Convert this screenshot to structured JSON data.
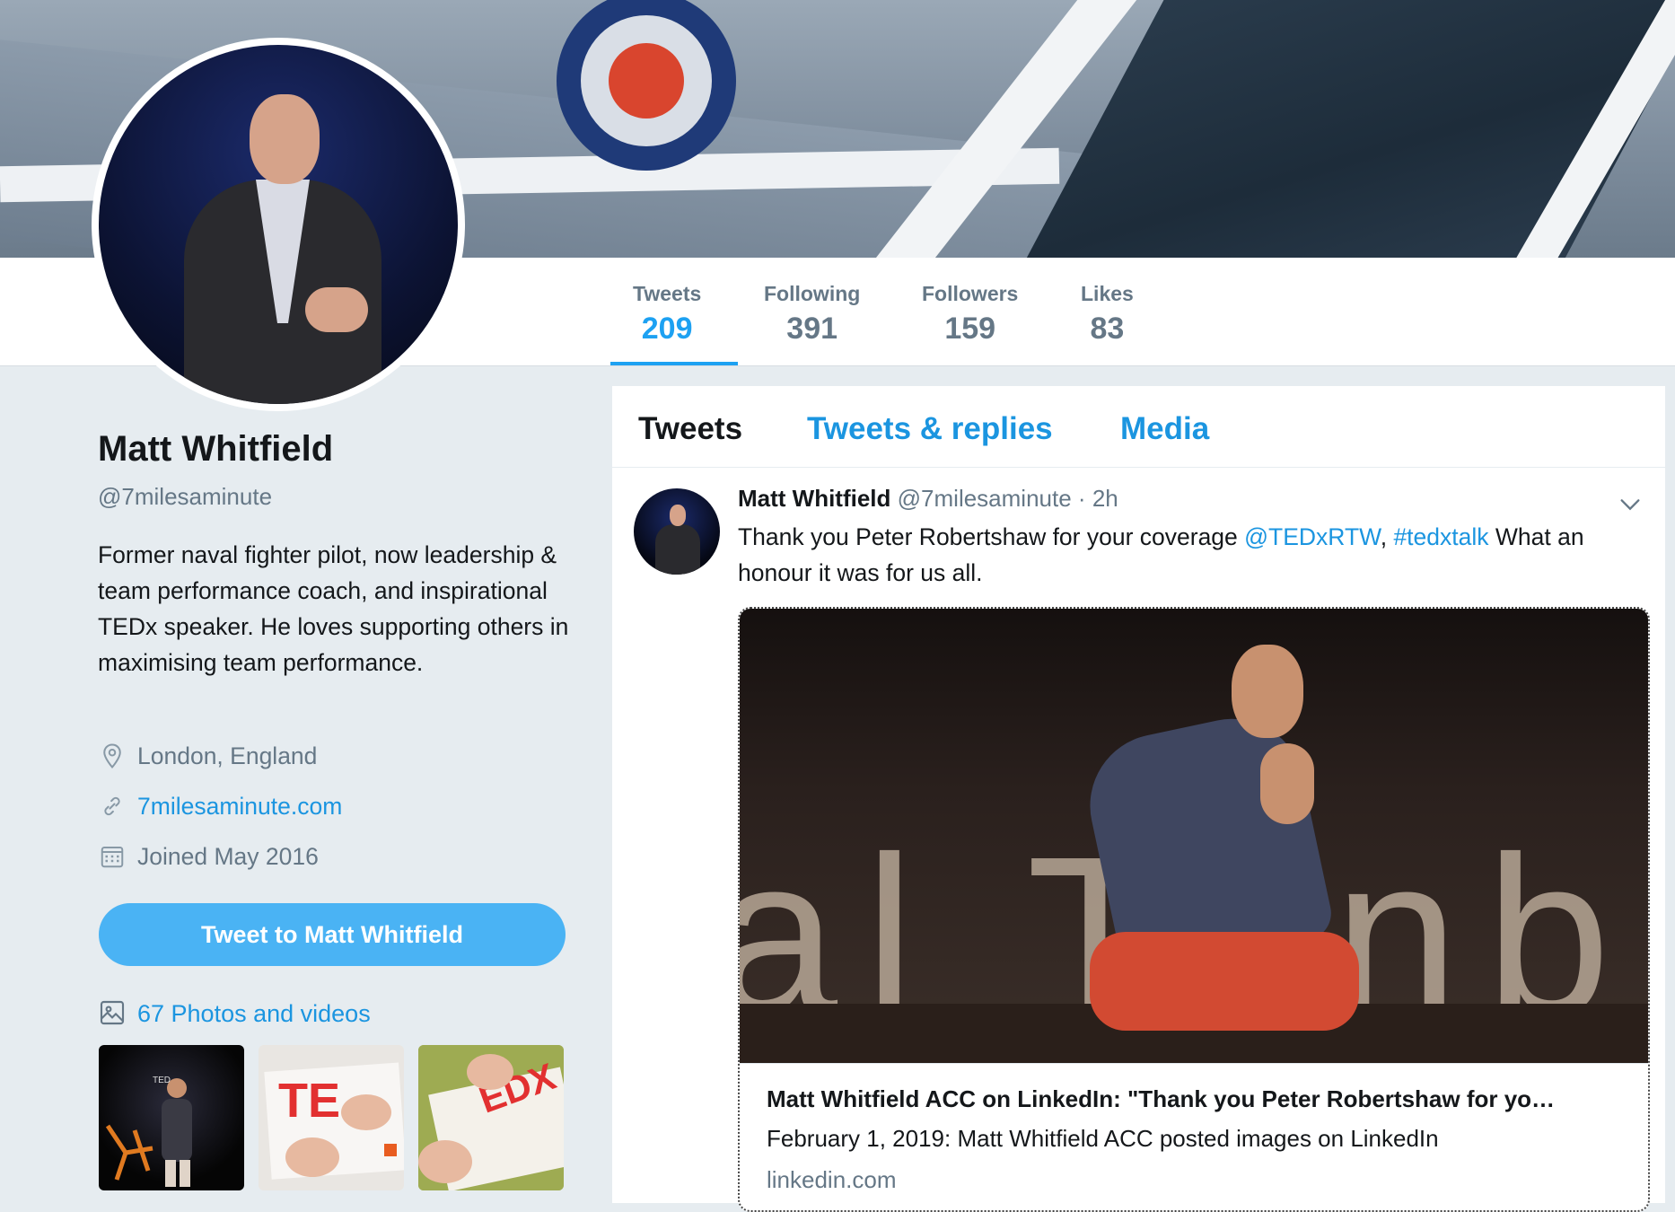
{
  "profile": {
    "name": "Matt Whitfield",
    "handle": "@7milesaminute",
    "bio": "Former naval fighter pilot, now leadership & team performance coach, and inspirational TEDx speaker. He loves supporting others in maximising team performance.",
    "location": "London, England",
    "website": "7milesaminute.com",
    "joined": "Joined May 2016",
    "tweet_to_label": "Tweet to Matt Whitfield",
    "photos_label": "67 Photos and videos"
  },
  "stats": [
    {
      "label": "Tweets",
      "value": "209",
      "active": true
    },
    {
      "label": "Following",
      "value": "391",
      "active": false
    },
    {
      "label": "Followers",
      "value": "159",
      "active": false
    },
    {
      "label": "Likes",
      "value": "83",
      "active": false
    }
  ],
  "tabs": [
    {
      "label": "Tweets",
      "active": true
    },
    {
      "label": "Tweets & replies",
      "active": false
    },
    {
      "label": "Media",
      "active": false
    }
  ],
  "tweet": {
    "author": "Matt Whitfield",
    "handle": "@7milesaminute",
    "separator": "·",
    "time": "2h",
    "text_before": "Thank you Peter Robertshaw for your coverage ",
    "mention": "@TEDxRTW",
    "comma": ", ",
    "hashtag": "#tedxtalk",
    "text_after": " What an honour it was for us all.",
    "card": {
      "title": "Matt Whitfield ACC on LinkedIn: \"Thank you Peter Robertshaw for yo…",
      "description": "February 1, 2019: Matt Whitfield ACC posted images on LinkedIn",
      "domain": "linkedin.com"
    }
  },
  "colors": {
    "accent": "#1da1f2",
    "link": "#1b95e0",
    "button": "#4ab3f4",
    "muted": "#657786",
    "background": "#e6ecf0"
  }
}
